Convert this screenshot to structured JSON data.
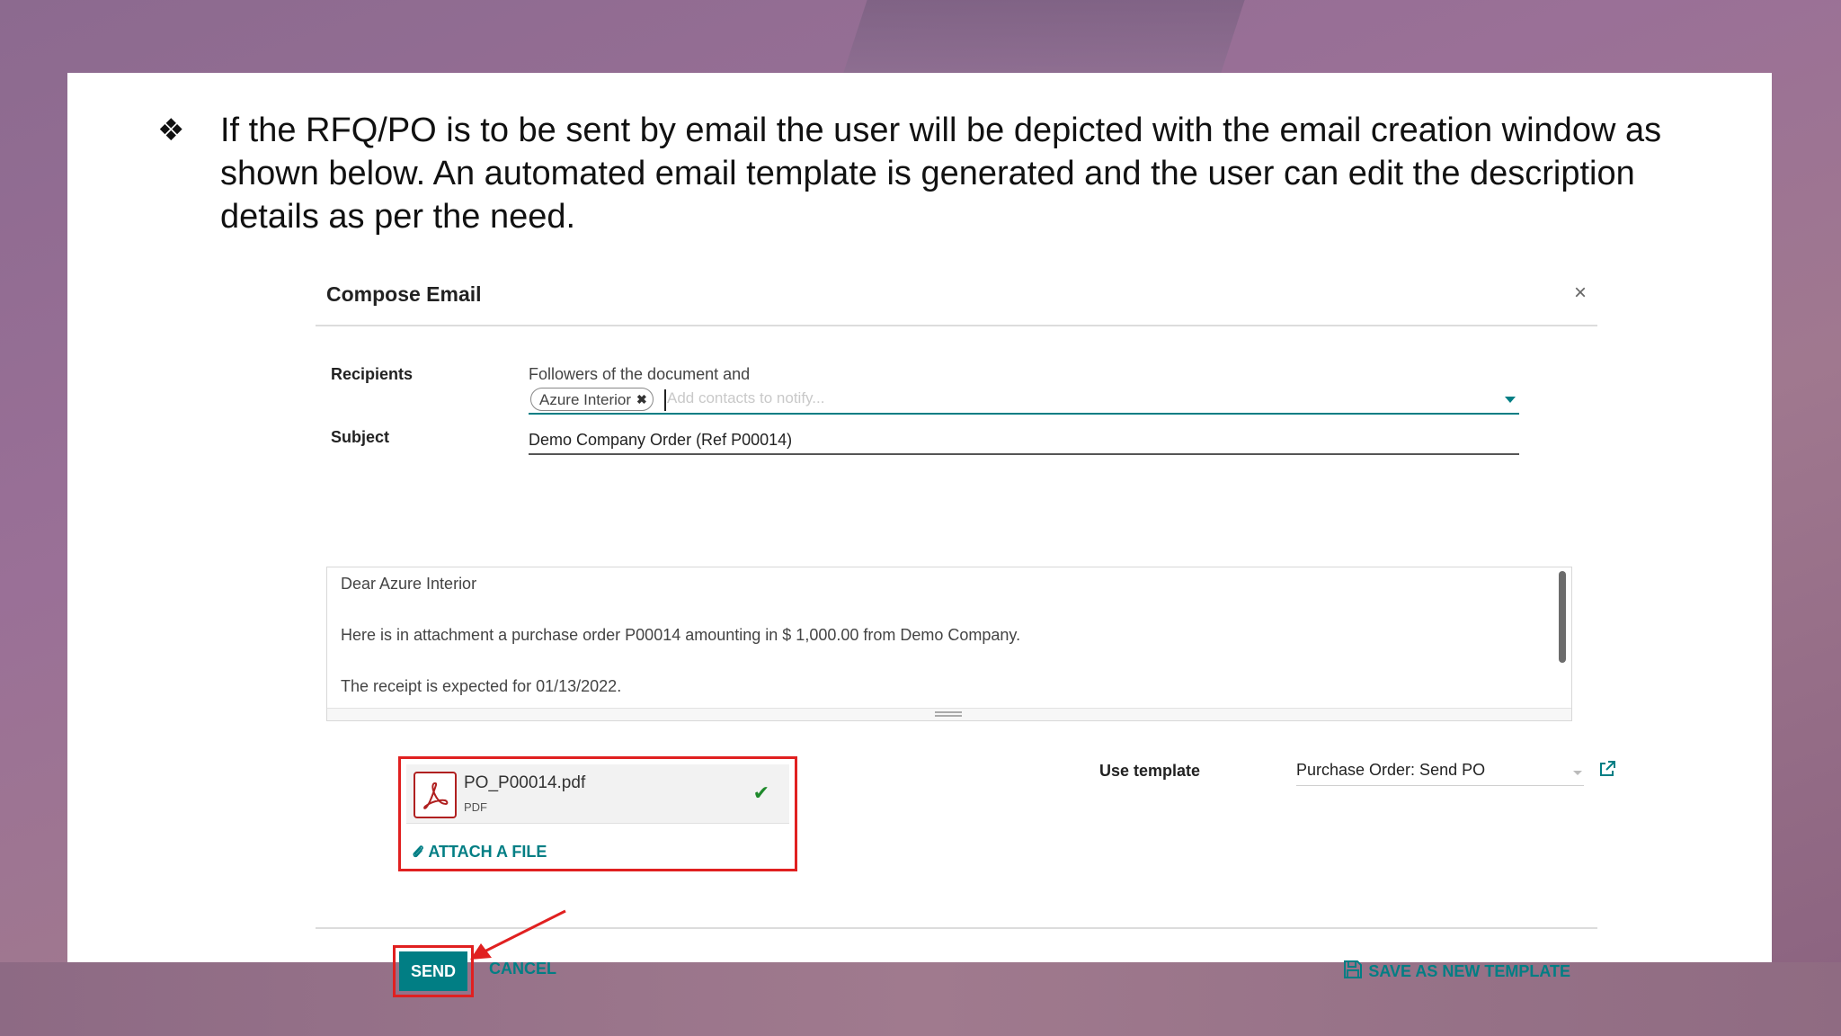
{
  "instruction": {
    "bullet": "❖",
    "text": "If the RFQ/PO is to be sent by email the user will be depicted with the email creation window as shown below. An automated email template is generated and the user can edit the description details as per the need."
  },
  "dialog": {
    "title": "Compose Email",
    "close": "×",
    "recipients_label": "Recipients",
    "followers_text": "Followers of the document and",
    "recipient_tag": "Azure Interior",
    "tag_remove": "✖",
    "contacts_placeholder": "Add contacts to notify...",
    "subject_label": "Subject",
    "subject_value": "Demo Company Order (Ref P00014)",
    "body": {
      "greeting": "Dear Azure Interior",
      "line1": "Here is in attachment a purchase order P00014 amounting in $ 1,000.00 from Demo Company.",
      "line2": "The receipt is expected for 01/13/2022."
    },
    "attachment": {
      "file_name": "PO_P00014.pdf",
      "file_type": "PDF",
      "check": "✔",
      "attach_label": "ATTACH A FILE"
    },
    "template_label": "Use template",
    "template_value": "Purchase Order: Send PO",
    "send_label": "SEND",
    "cancel_label": "CANCEL",
    "save_template_label": "SAVE AS NEW TEMPLATE"
  },
  "colors": {
    "accent": "#017e84",
    "highlight": "#e02020"
  }
}
